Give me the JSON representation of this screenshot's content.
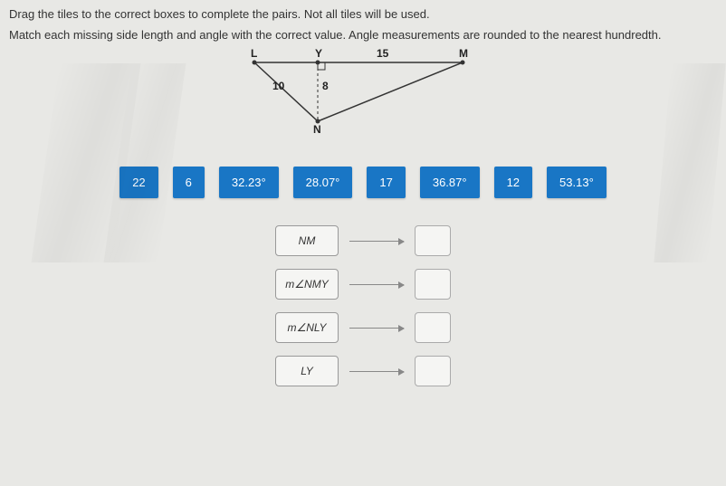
{
  "instructions": "Drag the tiles to the correct boxes to complete the pairs. Not all tiles will be used.",
  "subinstructions": "Match each missing side length and angle with the correct value. Angle measurements are rounded to the nearest hundredth.",
  "diagram": {
    "L": "L",
    "Y": "Y",
    "M": "M",
    "N": "N",
    "label_10": "10",
    "label_8": "8",
    "label_15": "15"
  },
  "tiles": [
    "22",
    "6",
    "32.23°",
    "28.07°",
    "17",
    "36.87°",
    "12",
    "53.13°"
  ],
  "pairs": [
    {
      "label": "NM"
    },
    {
      "label": "m∠NMY"
    },
    {
      "label": "m∠NLY"
    },
    {
      "label": "LY"
    }
  ]
}
